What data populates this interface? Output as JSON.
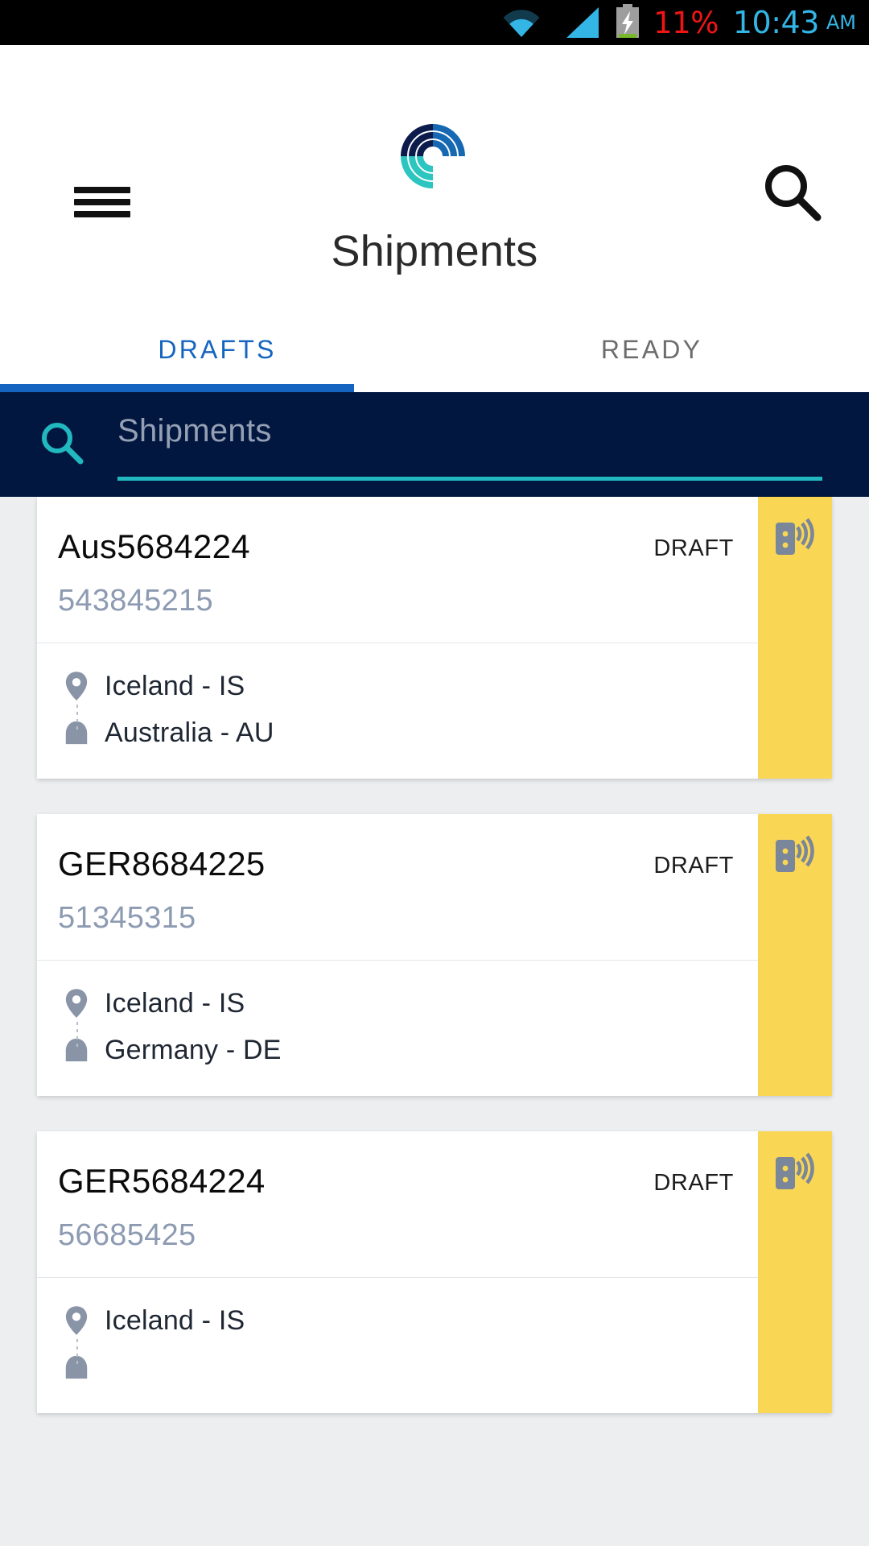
{
  "statusbar": {
    "battery_percent": "11%",
    "time": "10:43",
    "ampm": "AM",
    "icons": [
      "wifi-icon",
      "signal-icon",
      "battery-charging-icon"
    ],
    "colors": {
      "percent": "#f01515",
      "time": "#33b5e5",
      "background": "#000000"
    }
  },
  "header": {
    "title": "Shipments",
    "menu_icon": "hamburger-menu-icon",
    "search_icon": "search-icon",
    "logo_icon": "pinwheel-logo-icon",
    "logo_colors": {
      "navy": "#0d1b4c",
      "blue": "#1668b3",
      "teal": "#2cc5c0"
    }
  },
  "tabs": {
    "items": [
      {
        "label": "DRAFTS",
        "active": true
      },
      {
        "label": "READY",
        "active": false
      }
    ],
    "active_color": "#1565c0",
    "inactive_color": "#6c6c6c"
  },
  "search": {
    "placeholder": "Shipments",
    "value": "",
    "icon": "search-icon",
    "panel_color": "#02173f",
    "underline_color": "#21b8c0"
  },
  "shipments": [
    {
      "reference": "Aus5684224",
      "tracking": "543845215",
      "status": "DRAFT",
      "origin": "Iceland - IS",
      "destination": "Australia - AU",
      "origin_icon": "map-pin-icon",
      "destination_icon": "home-icon",
      "strip_icon": "device-signal-icon",
      "strip_color": "#f9d654"
    },
    {
      "reference": "GER8684225",
      "tracking": "51345315",
      "status": "DRAFT",
      "origin": "Iceland - IS",
      "destination": "Germany - DE",
      "origin_icon": "map-pin-icon",
      "destination_icon": "home-icon",
      "strip_icon": "device-signal-icon",
      "strip_color": "#f9d654"
    },
    {
      "reference": "GER5684224",
      "tracking": "56685425",
      "status": "DRAFT",
      "origin": "Iceland - IS",
      "destination": "",
      "origin_icon": "map-pin-icon",
      "destination_icon": "home-icon",
      "strip_icon": "device-signal-icon",
      "strip_color": "#f9d654"
    }
  ]
}
